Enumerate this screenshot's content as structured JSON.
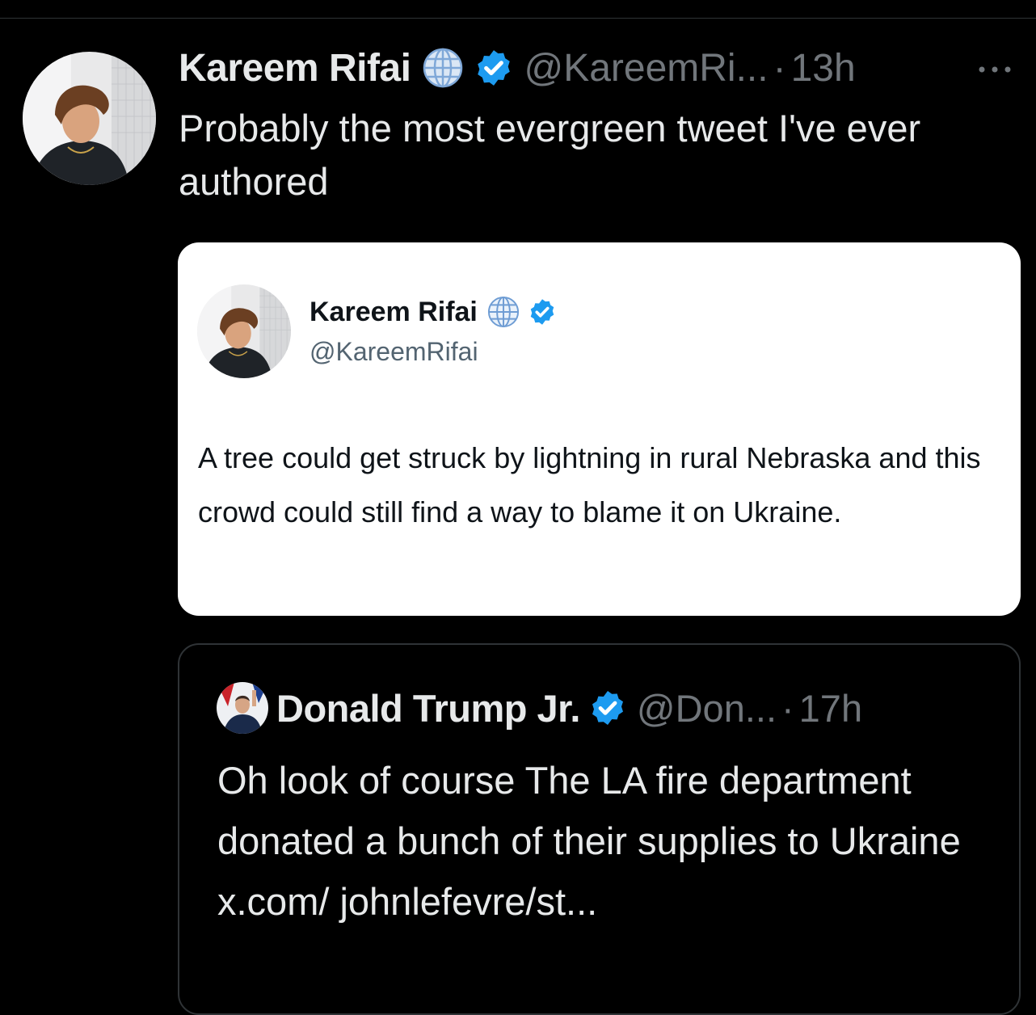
{
  "colors": {
    "background": "#000000",
    "primary_text": "#e7e9ea",
    "secondary_text": "#71767b",
    "verified_blue": "#1d9bf0",
    "card_background": "#ffffff",
    "card_text": "#0f1419",
    "card_secondary_text": "#536471",
    "border": "#2f3336"
  },
  "tweet": {
    "author_name": "Kareem Rifai",
    "handle": "@KareemRi...",
    "separator": "·",
    "time": "13h",
    "more_icon": "more-horizontal-icon",
    "text": "Probably the most evergreen tweet I've ever authored",
    "badges": [
      "globe-icon",
      "verified-badge-icon"
    ]
  },
  "screenshot": {
    "author_name": "Kareem Rifai",
    "handle": "@KareemRifai",
    "text": "A tree could get struck by lightning in rural Nebraska and this crowd could still find a way to blame it on Ukraine.",
    "badges": [
      "globe-icon",
      "verified-badge-icon"
    ]
  },
  "quoted_tweet": {
    "author_name": "Donald Trump Jr.",
    "handle": "@Don...",
    "separator": "·",
    "time": "17h",
    "text": "Oh look of course The LA fire department donated a bunch of their supplies to Ukraine x.com/ johnlefevre/st...",
    "badges": [
      "verified-badge-icon"
    ]
  }
}
